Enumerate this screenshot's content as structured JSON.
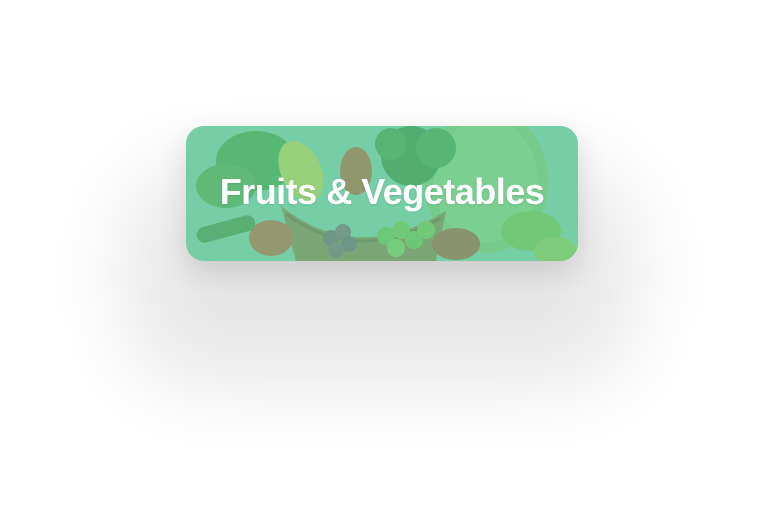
{
  "category_card": {
    "title": "Fruits & Vegetables",
    "image_icon": "fruits-vegetables-basket-image",
    "overlay_color": "#70CCA4"
  }
}
